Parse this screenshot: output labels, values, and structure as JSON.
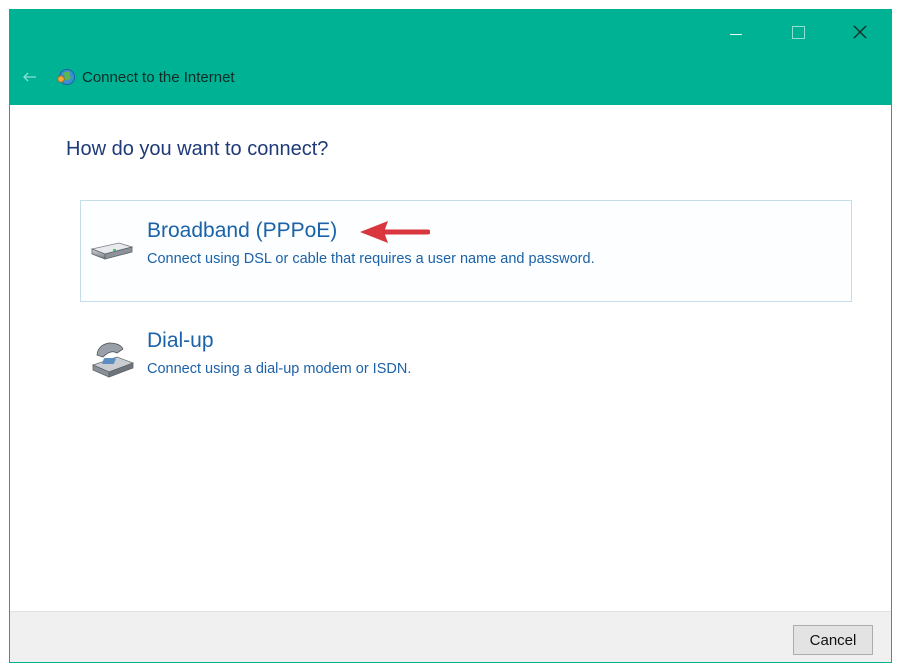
{
  "window": {
    "title": "Connect to the Internet",
    "accent": "#00b294",
    "controls": [
      "minimize-icon",
      "maximize-icon",
      "close-icon"
    ]
  },
  "page": {
    "heading": "How do you want to connect?"
  },
  "options": [
    {
      "title": "Broadband (PPPoE)",
      "description": "Connect using DSL or cable that requires a user name and password.",
      "icon": "modem-icon",
      "selected": true
    },
    {
      "title": "Dial-up",
      "description": "Connect using a dial-up modem or ISDN.",
      "icon": "telephone-icon",
      "selected": false
    }
  ],
  "annotation": {
    "icon": "red-arrow-icon",
    "color": "#d9363e"
  },
  "footer": {
    "cancel_label": "Cancel"
  }
}
